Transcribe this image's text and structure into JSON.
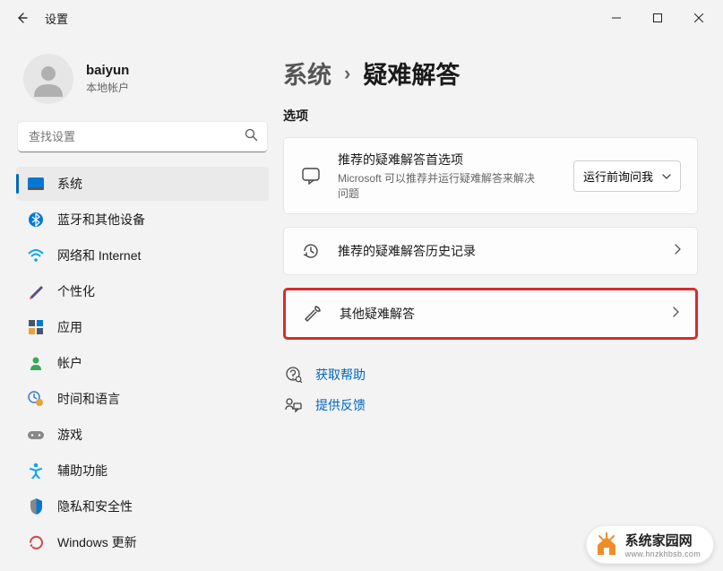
{
  "window": {
    "title": "设置"
  },
  "user": {
    "name": "baiyun",
    "subtitle": "本地帐户"
  },
  "search": {
    "placeholder": "查找设置"
  },
  "sidebar": {
    "items": [
      {
        "label": "系统"
      },
      {
        "label": "蓝牙和其他设备"
      },
      {
        "label": "网络和 Internet"
      },
      {
        "label": "个性化"
      },
      {
        "label": "应用"
      },
      {
        "label": "帐户"
      },
      {
        "label": "时间和语言"
      },
      {
        "label": "游戏"
      },
      {
        "label": "辅助功能"
      },
      {
        "label": "隐私和安全性"
      },
      {
        "label": "Windows 更新"
      }
    ]
  },
  "breadcrumb": {
    "parent": "系统",
    "current": "疑难解答"
  },
  "section": {
    "label": "选项"
  },
  "cards": {
    "recommended": {
      "title": "推荐的疑难解答首选项",
      "desc": "Microsoft 可以推荐并运行疑难解答来解决问题",
      "dropdown": "运行前询问我"
    },
    "history": {
      "title": "推荐的疑难解答历史记录"
    },
    "other": {
      "title": "其他疑难解答"
    }
  },
  "links": {
    "help": "获取帮助",
    "feedback": "提供反馈"
  },
  "watermark": {
    "text": "系统家园网",
    "url": "www.hnzkhbsb.com"
  }
}
